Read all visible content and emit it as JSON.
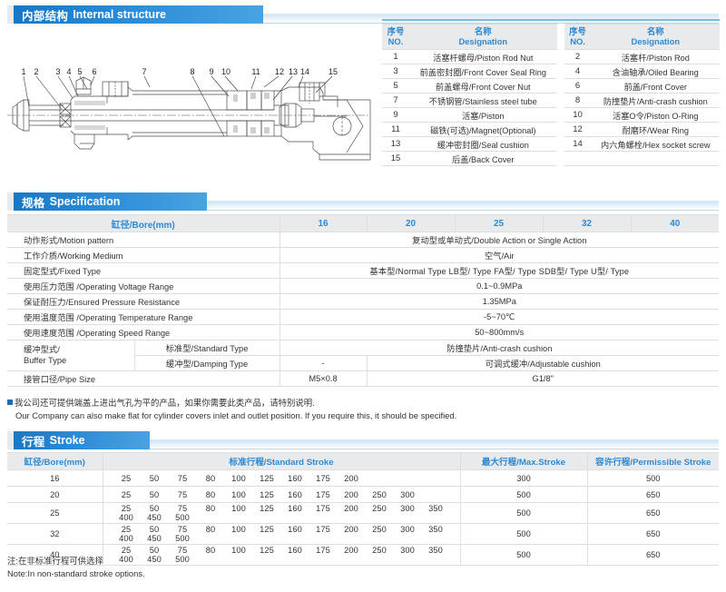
{
  "sections": {
    "internal_structure": {
      "cn": "内部结构",
      "en": "Internal structure"
    },
    "specification": {
      "cn": "规格",
      "en": "Specification"
    },
    "stroke": {
      "cn": "行程",
      "en": "Stroke"
    }
  },
  "colors": {
    "header_blue_dark": "#1878c8",
    "header_blue_light": "#49a3e2",
    "table_header_bg": "#e9eaec",
    "table_header_text": "#2b8ad4",
    "body_text": "#333333",
    "rule": "#dcdfe1"
  },
  "drawing": {
    "callouts": [
      "1",
      "2",
      "3",
      "4",
      "5",
      "6",
      "7",
      "8",
      "9",
      "10",
      "11",
      "12",
      "13",
      "14",
      "15"
    ],
    "description": "Sectional assembly drawing of a pneumatic cylinder"
  },
  "parts_table": {
    "headers": {
      "no_cn": "序号",
      "no_en": "NO.",
      "name_cn": "名称",
      "name_en": "Designation"
    },
    "rows": [
      {
        "left_no": "1",
        "left_name": "活塞杆螺母/Piston Rod Nut",
        "right_no": "2",
        "right_name": "活塞杆/Piston Rod"
      },
      {
        "left_no": "3",
        "left_name": "前盖密封圈/Front Cover Seal Ring",
        "right_no": "4",
        "right_name": "含油轴承/Oiled Bearing"
      },
      {
        "left_no": "5",
        "left_name": "前盖螺母/Front Cover Nut",
        "right_no": "6",
        "right_name": "前盖/Front Cover"
      },
      {
        "left_no": "7",
        "left_name": "不锈钢管/Stainless steel tube",
        "right_no": "8",
        "right_name": "防撞垫片/Anti-crash cushion"
      },
      {
        "left_no": "9",
        "left_name": "活塞/Piston",
        "right_no": "10",
        "right_name": "活塞O令/Piston O-Ring"
      },
      {
        "left_no": "11",
        "left_name": "磁铁(可选)/Magnet(Optional)",
        "right_no": "12",
        "right_name": "耐磨环/Wear Ring"
      },
      {
        "left_no": "13",
        "left_name": "缓冲密封圈/Seal cushion",
        "right_no": "14",
        "right_name": "内六角螺栓/Hex socket screw"
      },
      {
        "left_no": "15",
        "left_name": "后盖/Back Cover",
        "right_no": "",
        "right_name": ""
      }
    ]
  },
  "spec_table": {
    "bore_label": "缸径/Bore(mm)",
    "bore_values": [
      "16",
      "20",
      "25",
      "32",
      "40"
    ],
    "rows": [
      {
        "label": "动作形式/Motion pattern",
        "value": "复动型或单动式/Double Action or Single Action"
      },
      {
        "label": "工作介质/Working Medium",
        "value": "空气/Air"
      },
      {
        "label": "固定型式/Fixed Type",
        "value": "基本型/Normal Type     LB型/ Type     FA型/ Type     SDB型/ Type     U型/ Type"
      },
      {
        "label": "使用压力范围 /Operating Voltage Range",
        "value": "0.1~0.9MPa"
      },
      {
        "label": "保证耐压力/Ensured Pressure Resistance",
        "value": "1.35MPa"
      },
      {
        "label": "使用温度范围 /Operating Temperature Range",
        "value": "-5~70℃"
      },
      {
        "label": "使用速度范围 /Operating Speed Range",
        "value": "50~800mm/s"
      }
    ],
    "buffer": {
      "label_cn": "缓冲型式/",
      "label_en": "Buffer Type",
      "standard_label": "标准型/Standard Type",
      "standard_value": "防撞垫片/Anti-crash cushion",
      "damping_label": "缓冲型/Damping Type",
      "damping_16": "-",
      "damping_value": "可调式缓冲/Adjustable cushion"
    },
    "pipe": {
      "label": "接管口径/Pipe Size",
      "value_16": "M5×0.8",
      "value_rest": "G1/8\""
    }
  },
  "company_note": {
    "cn": "我公司还可提供端盖上进出气孔为平的产品，如果你需要此类产品，请特别说明.",
    "en": "Our Company can also make flat for cylinder covers inlet and outlet position. If you require this, it should be specified."
  },
  "stroke_table": {
    "headers": {
      "bore": "缸径/Bore(mm)",
      "standard": "标准行程/Standard Stroke",
      "max": "最大行程/Max.Stroke",
      "permissible": "容许行程/Permissible Stroke"
    },
    "rows": [
      {
        "bore": "16",
        "strokes": "25 50 75 80 100 125 160 175 200",
        "max": "300",
        "permissible": "500"
      },
      {
        "bore": "20",
        "strokes": "25 50 75 80 100 125 160 175 200 250 300",
        "max": "500",
        "permissible": "650"
      },
      {
        "bore": "25",
        "strokes": "25 50 75 80 100 125 160 175 200 250 300 350 400 450 500",
        "max": "500",
        "permissible": "650"
      },
      {
        "bore": "32",
        "strokes": "25 50 75 80 100 125 160 175 200 250 300 350 400 450 500",
        "max": "500",
        "permissible": "650"
      },
      {
        "bore": "40",
        "strokes": "25 50 75 80 100 125 160 175 200 250 300 350 400 450 500",
        "max": "500",
        "permissible": "650"
      }
    ]
  },
  "bottom_note": {
    "cn": "注:在非标准行程可供选择",
    "en": "Note:In non-standard stroke options."
  }
}
